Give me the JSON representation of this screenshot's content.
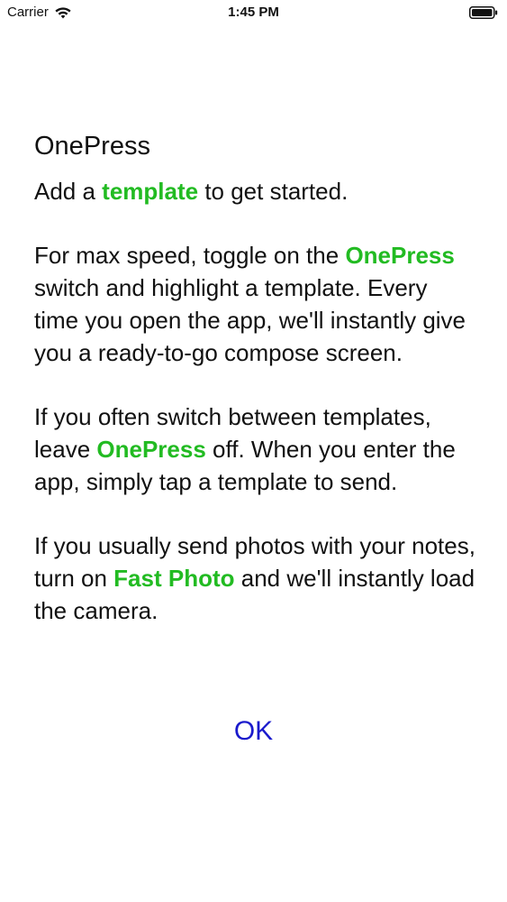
{
  "status_bar": {
    "carrier": "Carrier",
    "time": "1:45 PM",
    "icons": [
      "wifi-icon",
      "battery-icon"
    ]
  },
  "dialog": {
    "title": "OnePress",
    "p1": {
      "a": "Add a ",
      "hl": "template",
      "b": " to get started."
    },
    "p2": {
      "a": "For max speed, toggle on the ",
      "hl": "OnePress",
      "b": " switch and highlight a template. Every time you open the app, we'll instantly give you a ready-to-go compose screen."
    },
    "p3": {
      "a": "If you often switch between templates, leave ",
      "hl": "OnePress",
      "b": " off. When you enter the app, simply tap a template to send."
    },
    "p4": {
      "a": "If you usually send photos with your notes, turn on ",
      "hl": "Fast Photo",
      "b": " and we'll instantly load the camera."
    },
    "ok_label": "OK"
  },
  "colors": {
    "highlight": "#22bb22",
    "ok_button": "#1a1acc"
  }
}
